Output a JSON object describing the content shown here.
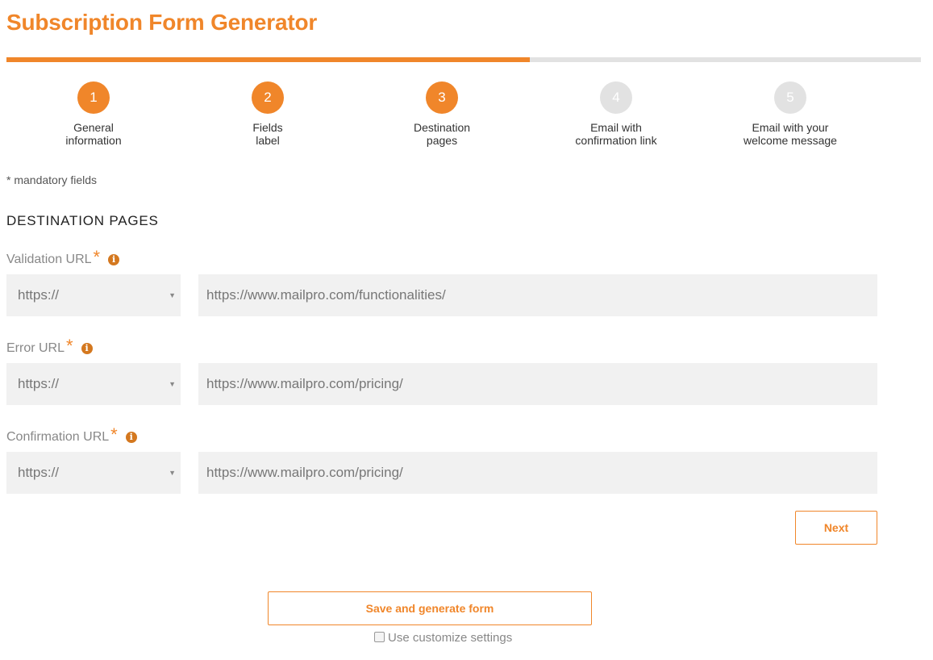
{
  "header": {
    "title": "Subscription Form Generator"
  },
  "progress": {
    "fraction": 0.572
  },
  "steps": [
    {
      "number": "1",
      "line1": "General",
      "line2": "information",
      "state": "active"
    },
    {
      "number": "2",
      "line1": "Fields",
      "line2": "label",
      "state": "active"
    },
    {
      "number": "3",
      "line1": "Destination",
      "line2": "pages",
      "state": "active"
    },
    {
      "number": "4",
      "line1": "Email with",
      "line2": "confirmation link",
      "state": "inactive"
    },
    {
      "number": "5",
      "line1": "Email with your",
      "line2": "welcome message",
      "state": "inactive"
    }
  ],
  "form": {
    "mandatory_note": "* mandatory fields",
    "section_title": "DESTINATION PAGES",
    "fields": [
      {
        "label": "Validation URL",
        "required_mark": "*",
        "info_icon": "info-icon",
        "protocol": "https://",
        "url": "https://www.mailpro.com/functionalities/"
      },
      {
        "label": "Error URL",
        "required_mark": "*",
        "info_icon": "info-icon",
        "protocol": "https://",
        "url": "https://www.mailpro.com/pricing/"
      },
      {
        "label": "Confirmation URL",
        "required_mark": "*",
        "info_icon": "info-icon",
        "protocol": "https://",
        "url": "https://www.mailpro.com/pricing/"
      }
    ],
    "next_label": "Next"
  },
  "footer": {
    "save_label": "Save and generate form",
    "customize_label": "Use customize settings",
    "customize_checked": false
  },
  "colors": {
    "accent": "#f0862a",
    "inactive": "#e2e2e2",
    "field_bg": "#f1f1f1"
  }
}
